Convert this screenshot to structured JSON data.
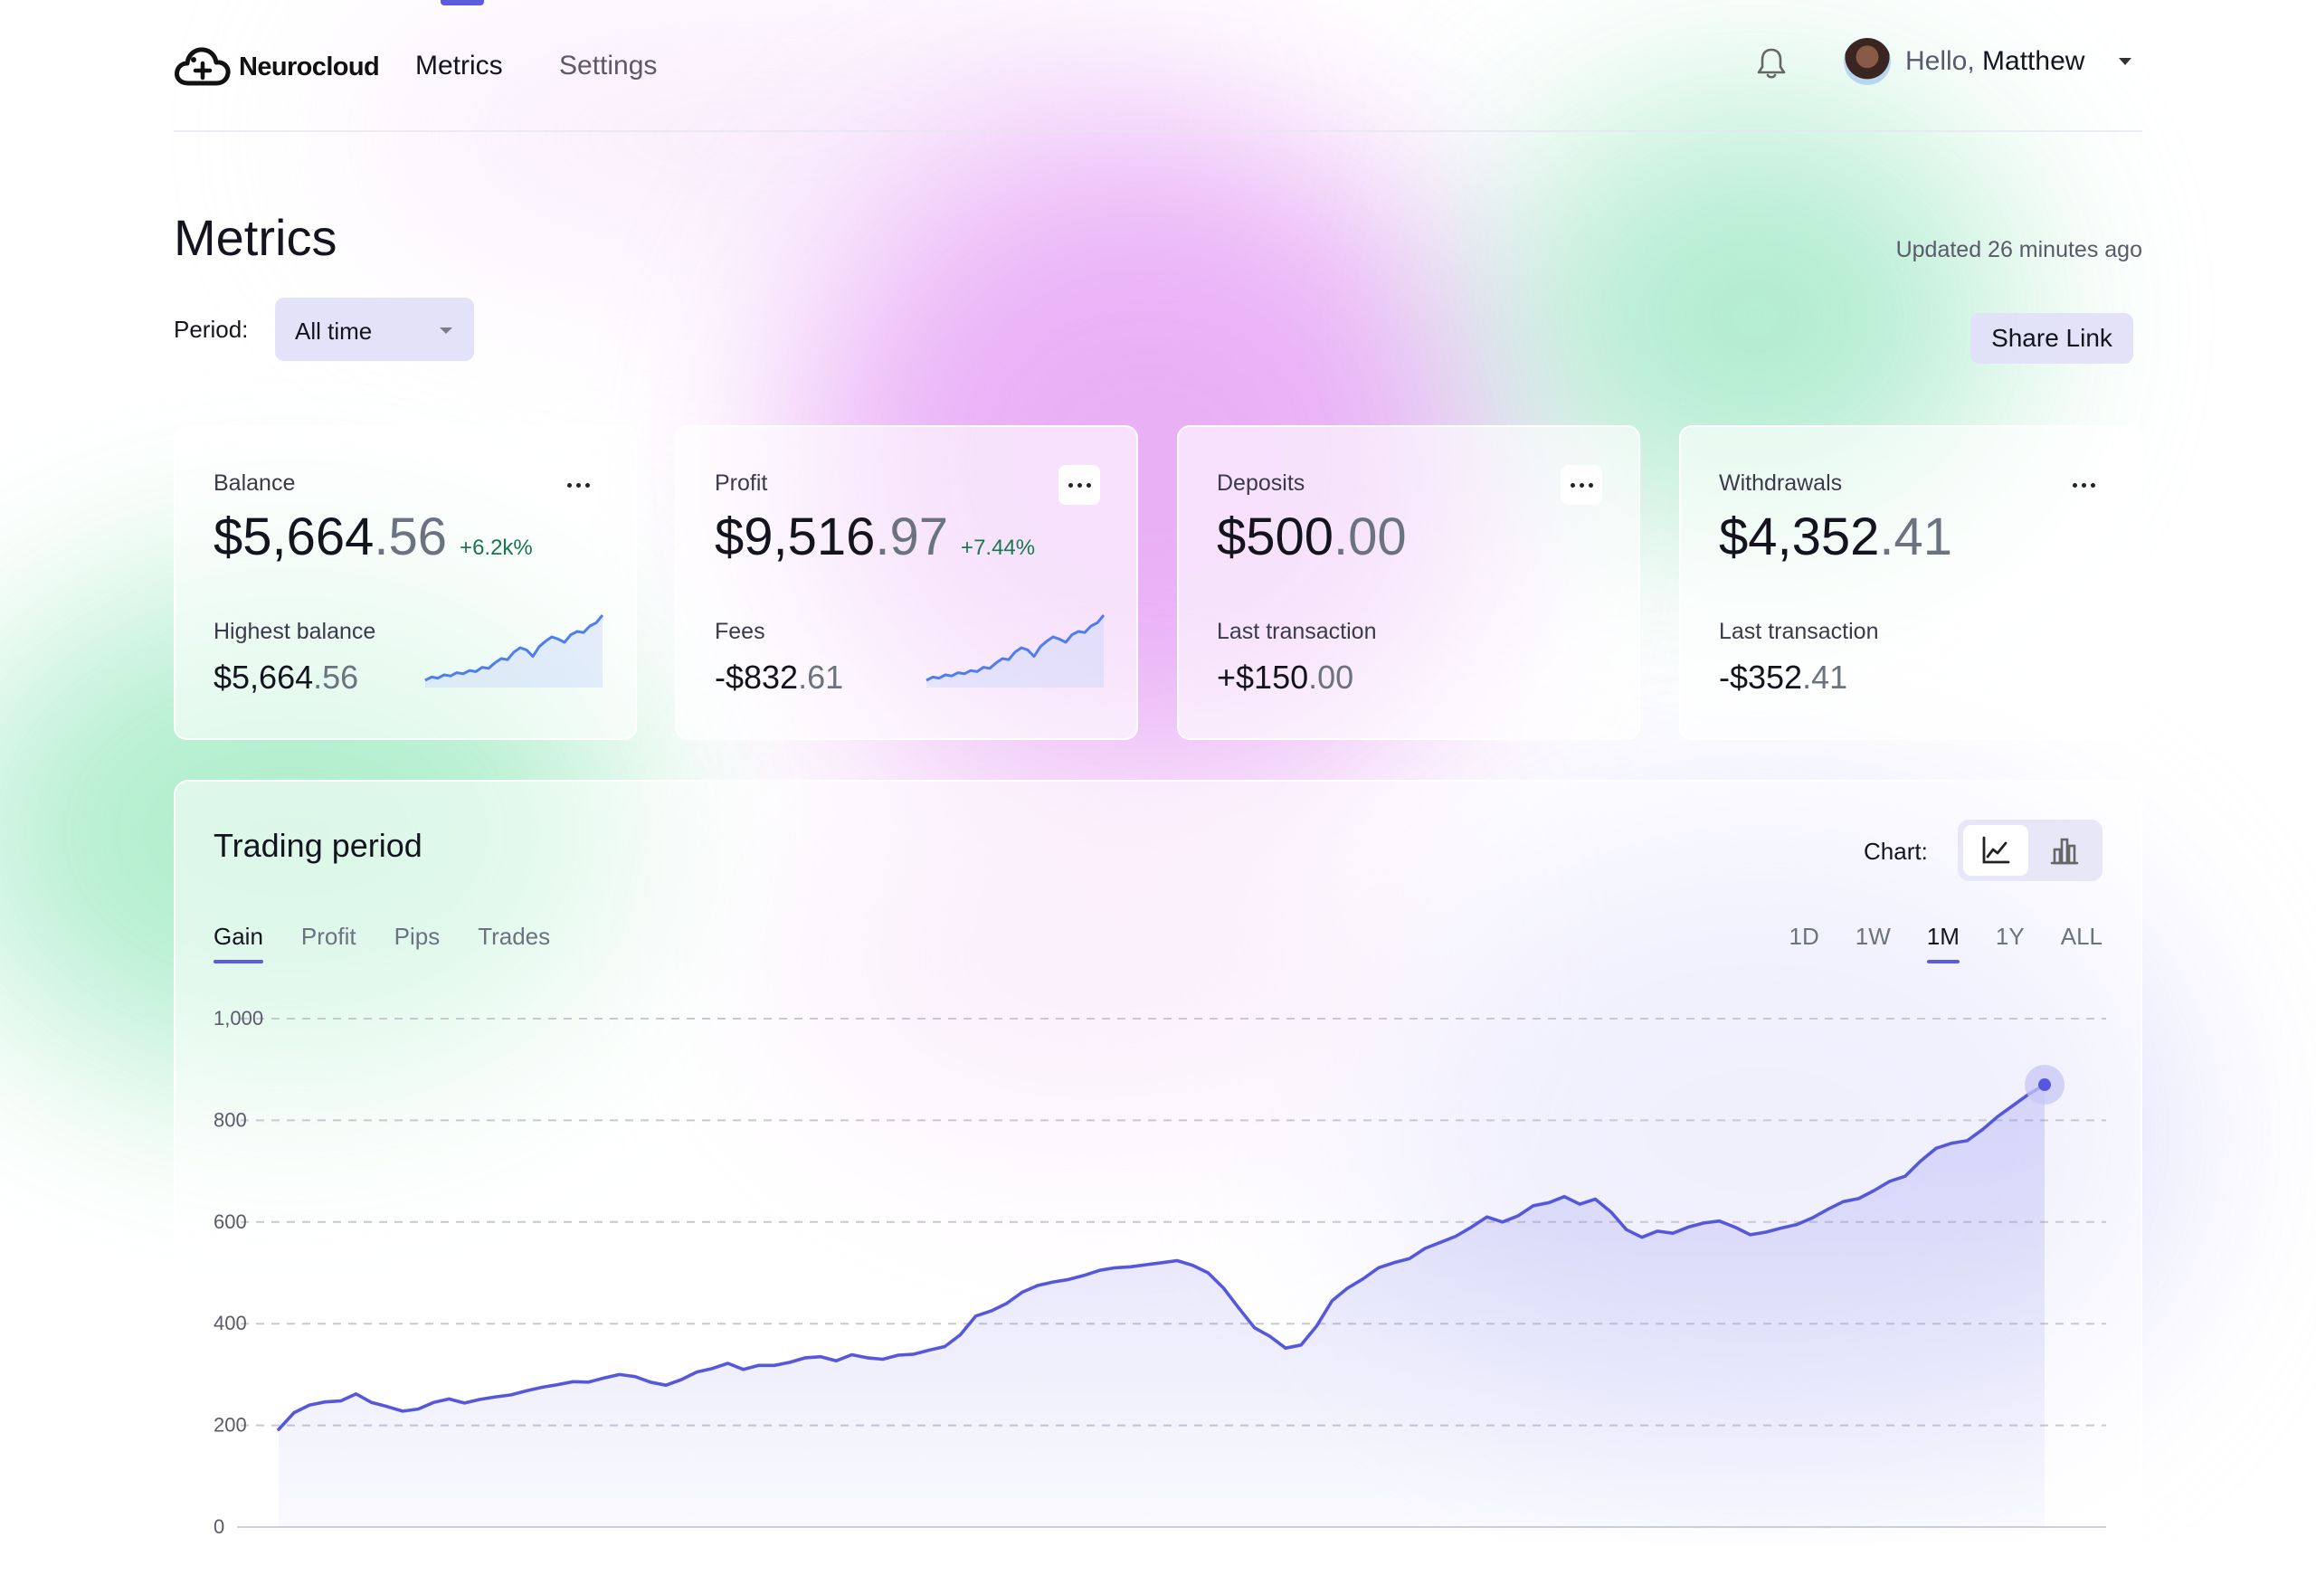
{
  "nav": {
    "brand": "Neurocloud",
    "links": [
      "Metrics",
      "Settings"
    ],
    "greeting": "Hello,",
    "user_name": "Matthew"
  },
  "header": {
    "title": "Metrics",
    "updated": "Updated 26 minutes ago",
    "period_label": "Period:",
    "period_value": "All time",
    "share_label": "Share Link"
  },
  "cards": [
    {
      "label": "Balance",
      "amount_main": "$5,664",
      "amount_cents": ".56",
      "delta": "+6.2k%",
      "sub_label": "Highest balance",
      "sub_main": "$5,664",
      "sub_cents": ".56"
    },
    {
      "label": "Profit",
      "amount_main": "$9,516",
      "amount_cents": ".97",
      "delta": "+7.44%",
      "sub_label": "Fees",
      "sub_main": "-$832",
      "sub_cents": ".61"
    },
    {
      "label": "Deposits",
      "amount_main": "$500",
      "amount_cents": ".00",
      "sub_label": "Last transaction",
      "sub_main": "+$150",
      "sub_cents": ".00"
    },
    {
      "label": "Withdrawals",
      "amount_main": "$4,352",
      "amount_cents": ".41",
      "sub_label": "Last transaction",
      "sub_main": "-$352",
      "sub_cents": ".41"
    }
  ],
  "trading": {
    "title": "Trading period",
    "chart_label": "Chart:",
    "tabs": [
      "Gain",
      "Profit",
      "Pips",
      "Trades"
    ],
    "active_tab": "Gain",
    "ranges": [
      "1D",
      "1W",
      "1M",
      "1Y",
      "ALL"
    ],
    "active_range": "1M"
  },
  "colors": {
    "accent": "#5b5ce0",
    "positive": "#16794d",
    "line": "#5558dc",
    "spark": "#4d7df0"
  },
  "icons": [
    "logo-cloud-icon",
    "bell-icon",
    "chevron-down-icon",
    "more-icon",
    "line-chart-icon",
    "bar-chart-icon"
  ],
  "chart_data": {
    "type": "line",
    "title": "",
    "xlabel": "",
    "ylabel": "",
    "ylim": [
      0,
      1000
    ],
    "yticks": [
      "0",
      "200",
      "400",
      "600",
      "800",
      "1,000"
    ],
    "grid": true,
    "x": [
      0,
      1,
      2,
      3,
      4,
      5,
      6,
      7,
      8,
      9,
      10,
      11,
      12,
      13,
      14,
      15,
      16,
      17,
      18,
      19,
      20,
      21,
      22,
      23,
      24,
      25,
      26,
      27,
      28,
      29,
      30,
      31,
      32,
      33,
      34,
      35,
      36,
      37,
      38,
      39,
      40,
      41,
      42,
      43,
      44,
      45,
      46,
      47,
      48,
      49,
      50,
      51,
      52,
      53,
      54,
      55,
      56,
      57,
      58,
      59,
      60,
      61,
      62,
      63,
      64,
      65,
      66,
      67,
      68,
      69,
      70,
      71,
      72,
      73,
      74,
      75,
      76,
      77,
      78,
      79,
      80,
      81,
      82,
      83,
      84,
      85,
      86,
      87,
      88,
      89,
      90,
      91,
      92,
      93,
      94,
      95,
      96,
      97,
      98,
      99,
      100,
      101,
      102,
      103,
      104,
      105,
      106,
      107,
      108,
      109,
      110,
      111,
      112,
      113,
      114
    ],
    "series": [
      {
        "values": [
          192,
          225,
          240,
          246,
          248,
          262,
          245,
          237,
          228,
          232,
          245,
          252,
          244,
          251,
          256,
          260,
          268,
          275,
          280,
          286,
          285,
          293,
          300,
          296,
          285,
          279,
          290,
          305,
          312,
          322,
          310,
          318,
          318,
          324,
          333,
          335,
          327,
          339,
          333,
          330,
          338,
          340,
          348,
          355,
          378,
          415,
          425,
          440,
          462,
          475,
          482,
          487,
          495,
          505,
          510,
          512,
          516,
          520,
          524,
          515,
          500,
          470,
          430,
          392,
          375,
          352,
          358,
          395,
          445,
          470,
          488,
          510,
          520,
          528,
          548,
          560,
          572,
          590,
          610,
          600,
          612,
          632,
          638,
          650,
          635,
          645,
          620,
          585,
          570,
          582,
          578,
          590,
          598,
          602,
          590,
          575,
          580,
          588,
          595,
          608,
          625,
          640,
          646,
          662,
          680,
          690,
          720,
          745,
          755,
          760,
          782,
          808,
          830,
          852,
          870
        ]
      }
    ]
  }
}
